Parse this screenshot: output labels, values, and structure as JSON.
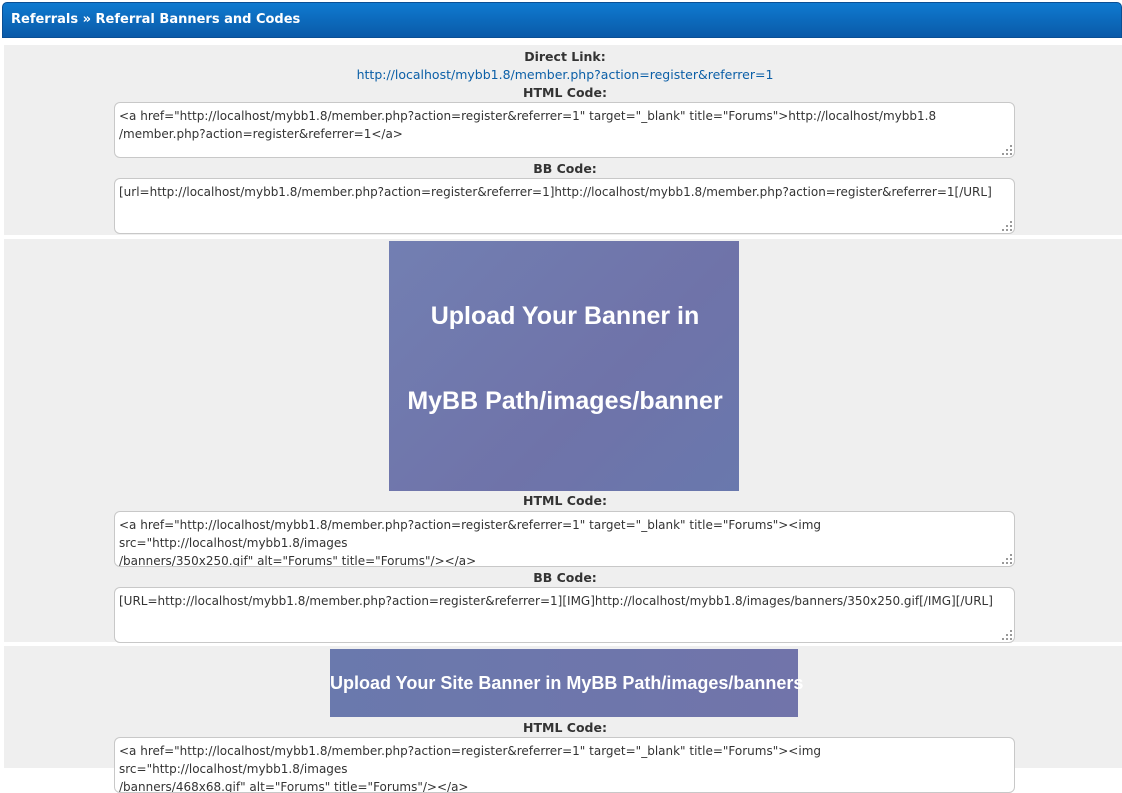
{
  "header": {
    "title": "Referrals » Referral Banners and Codes"
  },
  "sections": {
    "direct": {
      "direct_link_label": "Direct Link:",
      "direct_link_url": "http://localhost/mybb1.8/member.php?action=register&referrer=1",
      "html_label": "HTML Code:",
      "html_line1": "<a href=\"http://localhost/mybb1.8/member.php?action=register&referrer=1\" target=\"_blank\" title=\"Forums\">http://localhost/mybb1.8",
      "html_line2": "/member.php?action=register&referrer=1</a>",
      "bb_label": "BB Code:",
      "bb_line1": "[url=http://localhost/mybb1.8/member.php?action=register&referrer=1]http://localhost/mybb1.8/member.php?action=register&referrer=1[/URL]"
    },
    "banner_350": {
      "banner_line1": "Upload Your Banner in",
      "banner_line2": "MyBB Path/images/banner",
      "html_label": "HTML Code:",
      "html_line1": "<a href=\"http://localhost/mybb1.8/member.php?action=register&referrer=1\" target=\"_blank\" title=\"Forums\"><img src=\"http://localhost/mybb1.8/images",
      "html_line2": "/banners/350x250.gif\" alt=\"Forums\" title=\"Forums\"/></a>",
      "bb_label": "BB Code:",
      "bb_line1": "[URL=http://localhost/mybb1.8/member.php?action=register&referrer=1][IMG]http://localhost/mybb1.8/images/banners/350x250.gif[/IMG][/URL]"
    },
    "banner_468": {
      "banner_text": "Upload Your Site Banner in MyBB Path/images/banners",
      "html_label": "HTML Code:",
      "html_line1": "<a href=\"http://localhost/mybb1.8/member.php?action=register&referrer=1\" target=\"_blank\" title=\"Forums\"><img src=\"http://localhost/mybb1.8/images",
      "html_line2": "/banners/468x68.gif\" alt=\"Forums\" title=\"Forums\"/></a>"
    }
  },
  "colors": {
    "header_bg": "#0a5aa8",
    "link": "#0b5fa7",
    "panel_bg": "#efefef",
    "banner_bg": "#6f76ab"
  }
}
